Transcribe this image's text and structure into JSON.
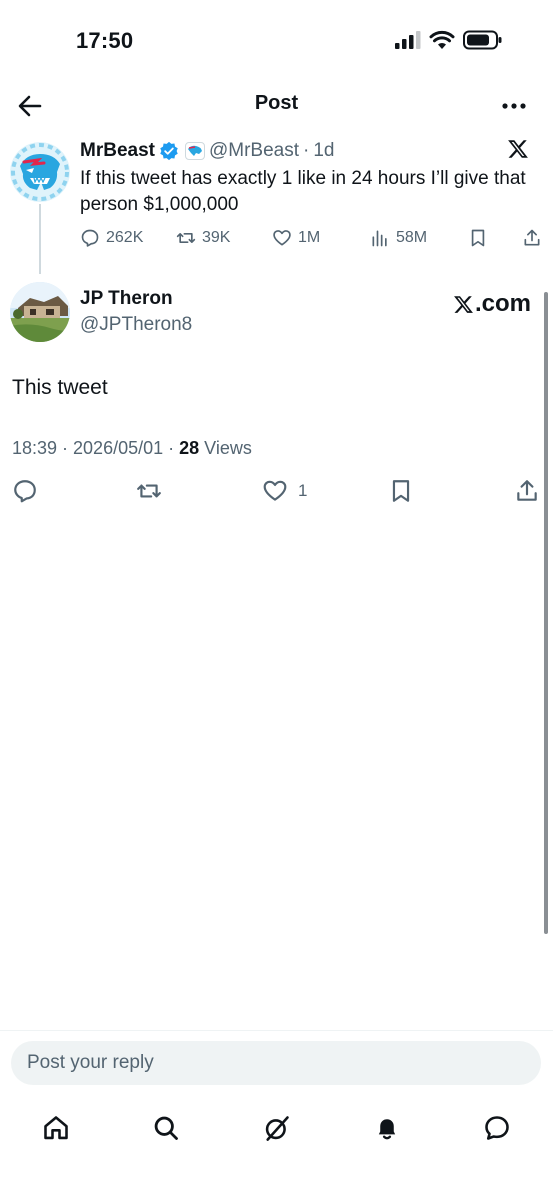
{
  "status_bar": {
    "time": "17:50"
  },
  "header": {
    "title": "Post"
  },
  "quoted_post": {
    "author_name": "MrBeast",
    "handle": "@MrBeast",
    "separator": "·",
    "time": "1d",
    "text": "If this tweet has exactly 1 like in 24 hours I’ll give that person $1,000,000",
    "stats": {
      "replies": "262K",
      "reposts": "39K",
      "likes": "1M",
      "views": "58M"
    }
  },
  "post": {
    "author_name": "JP Theron",
    "handle": "@JPTheron8",
    "watermark": "X.com",
    "watermark_text": ".com",
    "text": "This tweet",
    "timestamp": "18:39 · 2026/05/01 · ",
    "views_count": "28",
    "views_label": " Views",
    "like_count": "1"
  },
  "reply": {
    "placeholder": "Post your reply"
  },
  "icons": {
    "verified": "verified-badge-icon",
    "x_logo": "x-logo-icon"
  },
  "colors": {
    "verified_blue": "#1d9bf0",
    "text": "#0f1419",
    "secondary": "#536471"
  }
}
